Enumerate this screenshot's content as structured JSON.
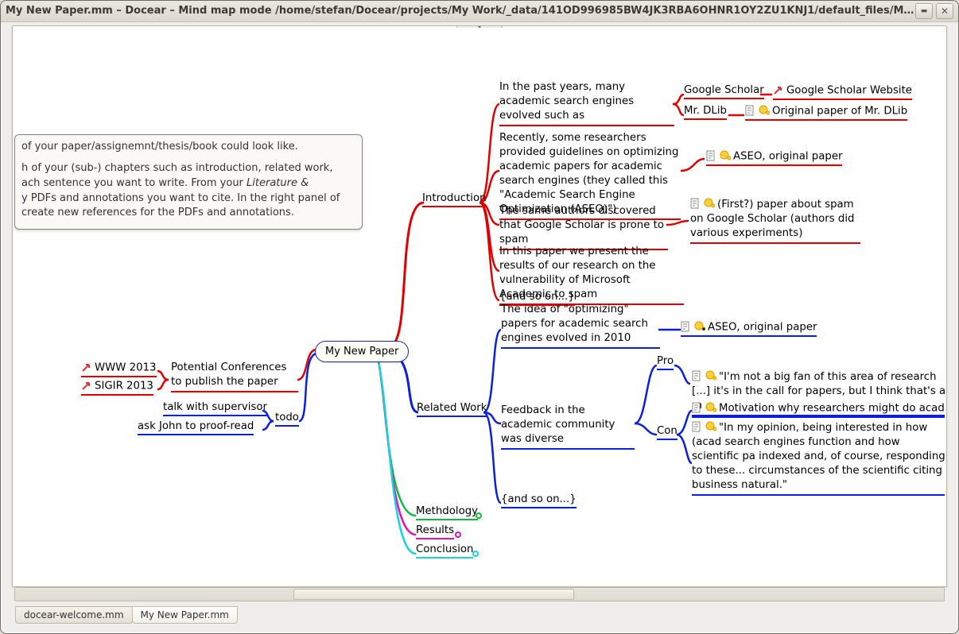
{
  "window": {
    "title": "My New Paper.mm – Docear – Mind map mode /home/stefan/Docear/projects/My Work/_data/141OD996985BW4JK3RBA6OHNR1OY2ZU1KNJ1/default_files/M..."
  },
  "tabs": [
    {
      "label": "docear-welcome.mm"
    },
    {
      "label": "My New Paper.mm"
    }
  ],
  "description": {
    "l1": " of your paper/assignemnt/thesis/book could look like.",
    "l2": "h of your (sub-) chapters such as introduction, related work,",
    "l3": "ach sentence you want to write. From your ",
    "l3i": "Literature &",
    "l4": "y PDFs and annotations you want to cite. In the right panel of",
    "l5": "create new references for the PDFs and annotations."
  },
  "root": {
    "label": "My New Paper"
  },
  "sections": {
    "intro": "Introduction",
    "related": "Related Work",
    "method": "Methdology",
    "results": "Results",
    "conclusion": "Conclusion"
  },
  "intro": {
    "n1": "In the past years, many academic search engines evolved such as",
    "n1a": "Google Scholar",
    "n1a_ref": "Google Scholar Website",
    "n1b": "Mr. DLib",
    "n1b_ref": "Original paper of Mr. DLib",
    "n2": "Recently, some researchers provided guidelines on optimizing academic papers for academic search engines (they called this \"Academic Search Engine Optimization (ASEO)\")",
    "n2_ref": "ASEO, original paper",
    "n3": "The same authors discovered that Google Scholar is prone to spam",
    "n3_ref": "(First?) paper about spam on Google Scholar (authors did various experiments)",
    "n4": "In this paper we present the results of our research on the vulnerability of Microsoft Academic to spam",
    "n5": "{and so on...}"
  },
  "related": {
    "n1": "The idea of \"optimizing\" papers for academic search engines evolved in 2010",
    "n1_ref": "ASEO, original paper",
    "n2": "Feedback in the academic community was diverse",
    "pro": "Pro",
    "con": "Con",
    "pro1": "\"I'm not a big fan of this area of research [...]  it's in the call for papers, but I think that's a m",
    "con1": "Motivation why researchers might do academ",
    "con2": "\"In my opinion, being interested in how (acad  search engines function and how scientific pa  indexed and, of course, responding to these... circumstances of the scientific citing business  natural.\"",
    "n3": "{and so on...}"
  },
  "left": {
    "conf": "Potential Conferences to publish the paper",
    "www": "WWW 2013",
    "sigir": "SIGIR 2013",
    "todo": "todo",
    "t1": "talk with supervisor",
    "t2": "ask John to proof-read"
  }
}
